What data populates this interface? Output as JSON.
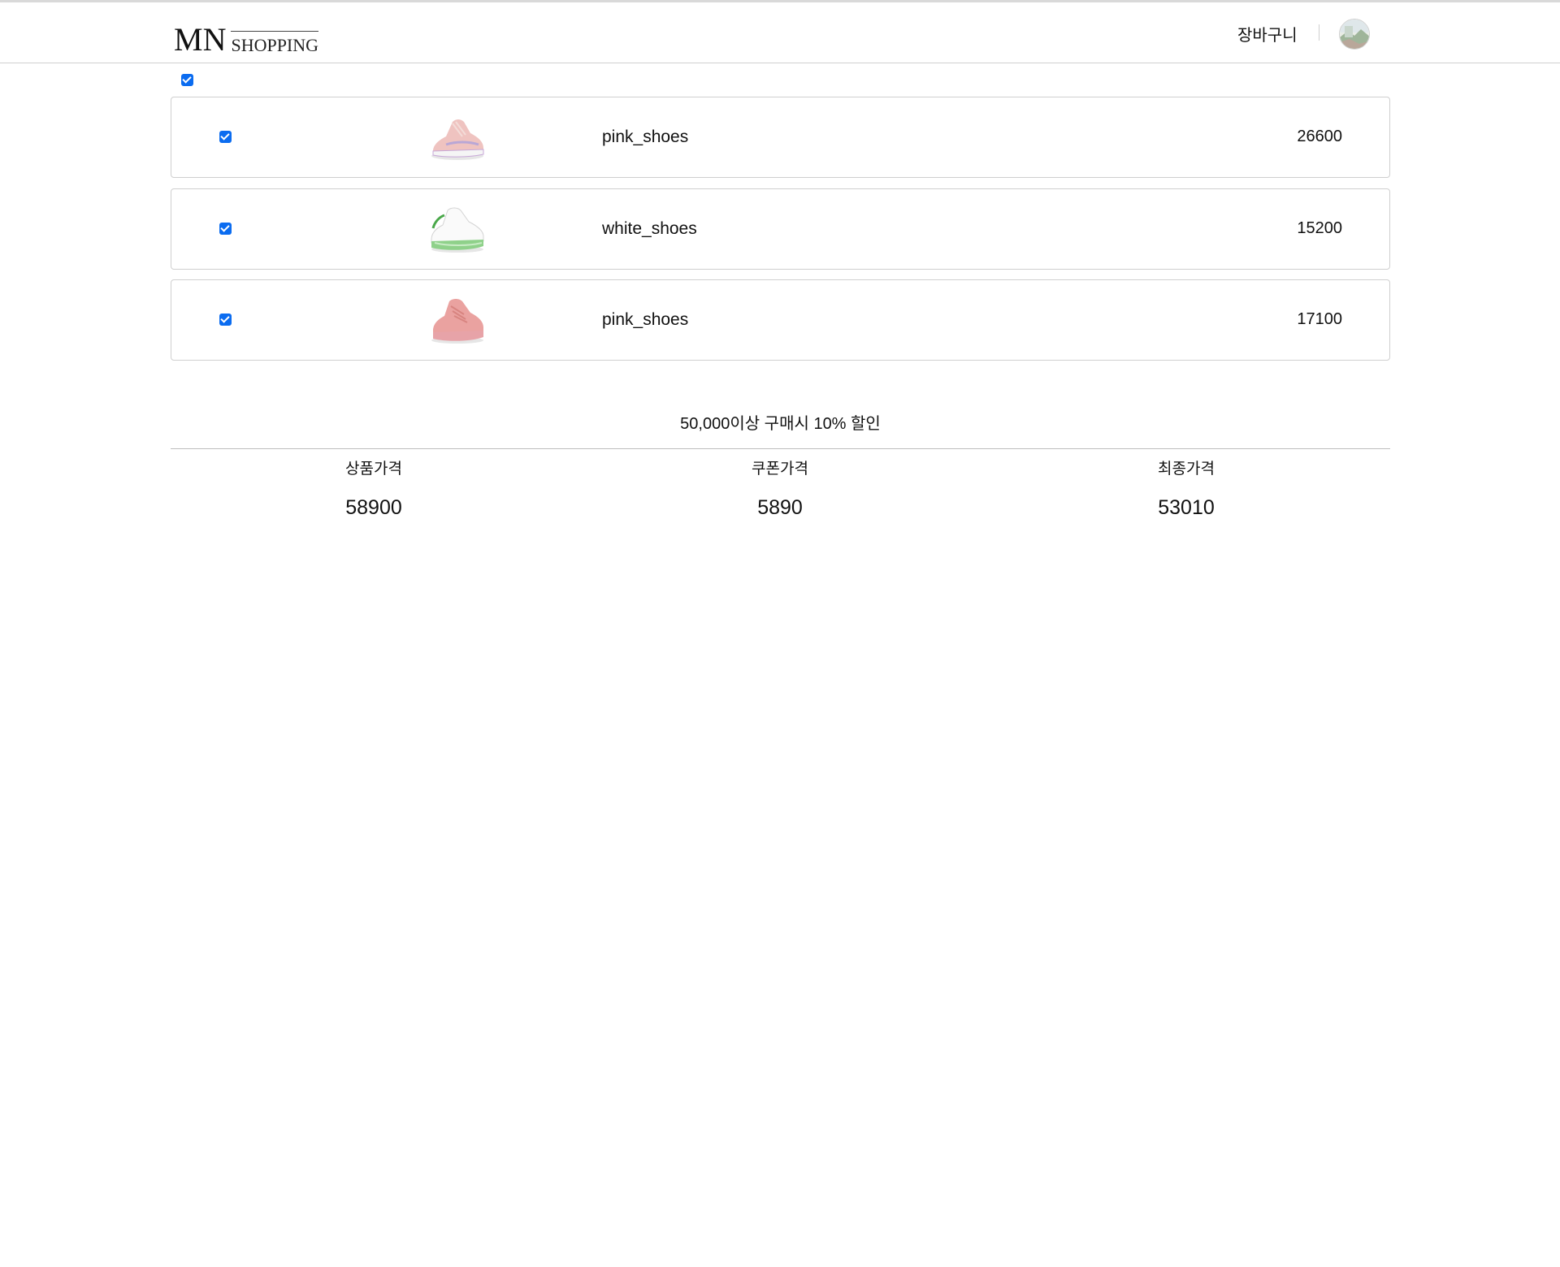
{
  "header": {
    "logo_main": "MN",
    "logo_sub": "SHOPPING",
    "cart_label": "장바구니"
  },
  "cart": {
    "items": [
      {
        "name": "pink_shoes",
        "price": "26600",
        "checked": true,
        "thumb": "pink-sneaker-icon"
      },
      {
        "name": "white_shoes",
        "price": "15200",
        "checked": true,
        "thumb": "white-green-sneaker-icon"
      },
      {
        "name": "pink_shoes",
        "price": "17100",
        "checked": true,
        "thumb": "pink-suede-sneaker-icon"
      }
    ]
  },
  "notice": "50,000이상 구매시 10% 할인",
  "summary": {
    "product_label": "상품가격",
    "product_value": "58900",
    "coupon_label": "쿠폰가격",
    "coupon_value": "5890",
    "final_label": "최종가격",
    "final_value": "53010"
  },
  "colors": {
    "checkbox": "#0b6cf0",
    "border": "#cfcfcf"
  }
}
